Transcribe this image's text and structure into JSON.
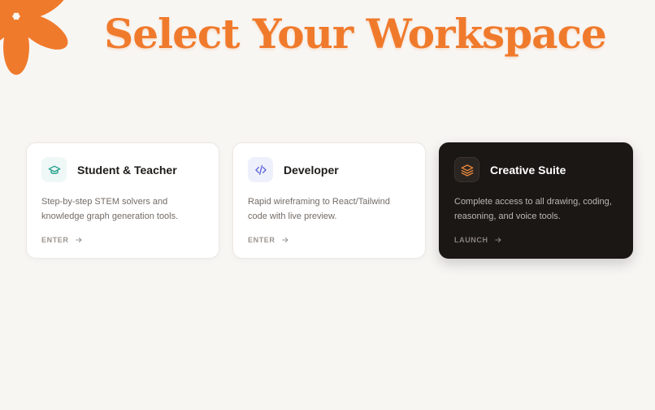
{
  "page": {
    "title": "Select Your Workspace"
  },
  "colors": {
    "accent": "#f07a2c",
    "background": "#f8f6f3",
    "card_light": "#ffffff",
    "card_dark": "#1b1715",
    "teal_icon": "#1f9e8a",
    "blue_icon": "#5b63d6",
    "orange_icon": "#f08a3a"
  },
  "cards": [
    {
      "title": "Student & Teacher",
      "description": "Step-by-step STEM solvers and knowledge graph generation tools.",
      "cta": "ENTER",
      "icon": "graduation-cap-icon",
      "theme": "light"
    },
    {
      "title": "Developer",
      "description": "Rapid wireframing to React/Tailwind code with live preview.",
      "cta": "ENTER",
      "icon": "code-icon",
      "theme": "light"
    },
    {
      "title": "Creative Suite",
      "description": "Complete access to all drawing, coding, reasoning, and voice tools.",
      "cta": "LAUNCH",
      "icon": "layers-icon",
      "theme": "dark"
    }
  ]
}
